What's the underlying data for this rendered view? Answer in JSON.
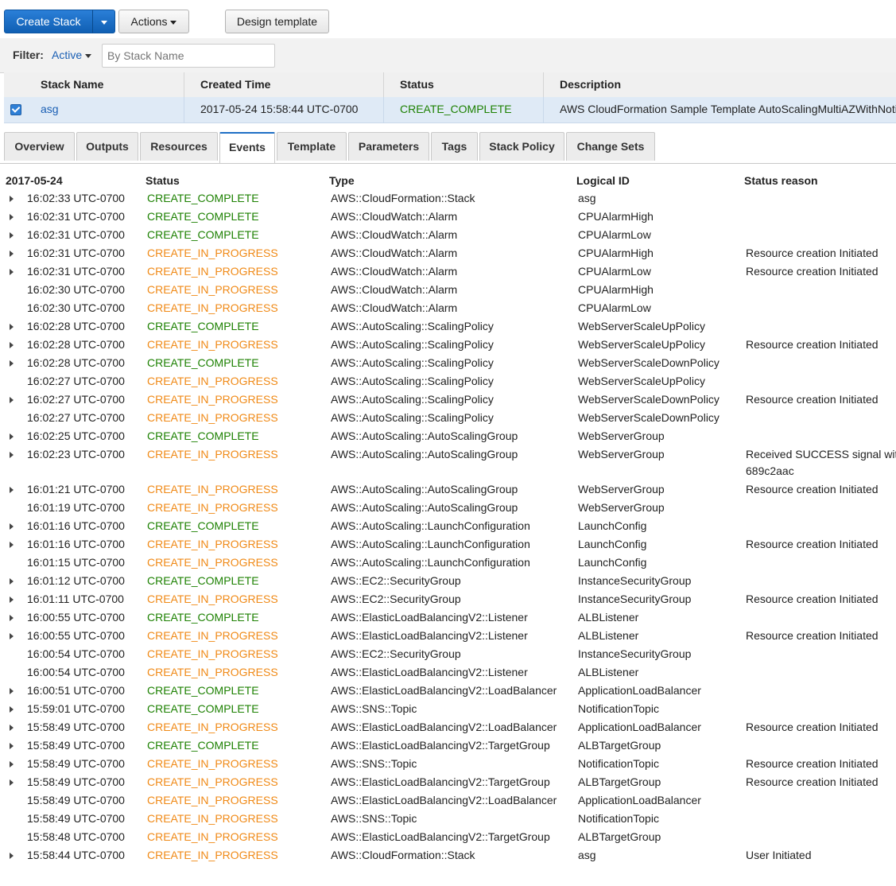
{
  "toolbar": {
    "create_stack": "Create Stack",
    "actions": "Actions",
    "design_template": "Design template"
  },
  "filter": {
    "label": "Filter:",
    "value": "Active",
    "search_placeholder": "By Stack Name"
  },
  "stack_table": {
    "headers": [
      "Stack Name",
      "Created Time",
      "Status",
      "Description"
    ],
    "row": {
      "name": "asg",
      "created": "2017-05-24 15:58:44 UTC-0700",
      "status": "CREATE_COMPLETE",
      "description": "AWS CloudFormation Sample Template AutoScalingMultiAZWithNotifications"
    }
  },
  "tabs": [
    "Overview",
    "Outputs",
    "Resources",
    "Events",
    "Template",
    "Parameters",
    "Tags",
    "Stack Policy",
    "Change Sets"
  ],
  "active_tab": "Events",
  "events": {
    "headers": {
      "date": "2017-05-24",
      "status": "Status",
      "type": "Type",
      "logical_id": "Logical ID",
      "reason": "Status reason"
    },
    "rows": [
      {
        "expandable": true,
        "time": "16:02:33 UTC-0700",
        "status": "CREATE_COMPLETE",
        "type": "AWS::CloudFormation::Stack",
        "logical_id": "asg",
        "reason": ""
      },
      {
        "expandable": true,
        "time": "16:02:31 UTC-0700",
        "status": "CREATE_COMPLETE",
        "type": "AWS::CloudWatch::Alarm",
        "logical_id": "CPUAlarmHigh",
        "reason": ""
      },
      {
        "expandable": true,
        "time": "16:02:31 UTC-0700",
        "status": "CREATE_COMPLETE",
        "type": "AWS::CloudWatch::Alarm",
        "logical_id": "CPUAlarmLow",
        "reason": ""
      },
      {
        "expandable": true,
        "time": "16:02:31 UTC-0700",
        "status": "CREATE_IN_PROGRESS",
        "type": "AWS::CloudWatch::Alarm",
        "logical_id": "CPUAlarmHigh",
        "reason": "Resource creation Initiated"
      },
      {
        "expandable": true,
        "time": "16:02:31 UTC-0700",
        "status": "CREATE_IN_PROGRESS",
        "type": "AWS::CloudWatch::Alarm",
        "logical_id": "CPUAlarmLow",
        "reason": "Resource creation Initiated"
      },
      {
        "expandable": false,
        "time": "16:02:30 UTC-0700",
        "status": "CREATE_IN_PROGRESS",
        "type": "AWS::CloudWatch::Alarm",
        "logical_id": "CPUAlarmHigh",
        "reason": ""
      },
      {
        "expandable": false,
        "time": "16:02:30 UTC-0700",
        "status": "CREATE_IN_PROGRESS",
        "type": "AWS::CloudWatch::Alarm",
        "logical_id": "CPUAlarmLow",
        "reason": ""
      },
      {
        "expandable": true,
        "time": "16:02:28 UTC-0700",
        "status": "CREATE_COMPLETE",
        "type": "AWS::AutoScaling::ScalingPolicy",
        "logical_id": "WebServerScaleUpPolicy",
        "reason": ""
      },
      {
        "expandable": true,
        "time": "16:02:28 UTC-0700",
        "status": "CREATE_IN_PROGRESS",
        "type": "AWS::AutoScaling::ScalingPolicy",
        "logical_id": "WebServerScaleUpPolicy",
        "reason": "Resource creation Initiated"
      },
      {
        "expandable": true,
        "time": "16:02:28 UTC-0700",
        "status": "CREATE_COMPLETE",
        "type": "AWS::AutoScaling::ScalingPolicy",
        "logical_id": "WebServerScaleDownPolicy",
        "reason": ""
      },
      {
        "expandable": false,
        "time": "16:02:27 UTC-0700",
        "status": "CREATE_IN_PROGRESS",
        "type": "AWS::AutoScaling::ScalingPolicy",
        "logical_id": "WebServerScaleUpPolicy",
        "reason": ""
      },
      {
        "expandable": true,
        "time": "16:02:27 UTC-0700",
        "status": "CREATE_IN_PROGRESS",
        "type": "AWS::AutoScaling::ScalingPolicy",
        "logical_id": "WebServerScaleDownPolicy",
        "reason": "Resource creation Initiated"
      },
      {
        "expandable": false,
        "time": "16:02:27 UTC-0700",
        "status": "CREATE_IN_PROGRESS",
        "type": "AWS::AutoScaling::ScalingPolicy",
        "logical_id": "WebServerScaleDownPolicy",
        "reason": ""
      },
      {
        "expandable": true,
        "time": "16:02:25 UTC-0700",
        "status": "CREATE_COMPLETE",
        "type": "AWS::AutoScaling::AutoScalingGroup",
        "logical_id": "WebServerGroup",
        "reason": ""
      },
      {
        "expandable": true,
        "time": "16:02:23 UTC-0700",
        "status": "CREATE_IN_PROGRESS",
        "type": "AWS::AutoScaling::AutoScalingGroup",
        "logical_id": "WebServerGroup",
        "reason": "Received SUCCESS signal wit",
        "reason2": "689c2aac"
      },
      {
        "expandable": true,
        "time": "16:01:21 UTC-0700",
        "status": "CREATE_IN_PROGRESS",
        "type": "AWS::AutoScaling::AutoScalingGroup",
        "logical_id": "WebServerGroup",
        "reason": "Resource creation Initiated"
      },
      {
        "expandable": false,
        "time": "16:01:19 UTC-0700",
        "status": "CREATE_IN_PROGRESS",
        "type": "AWS::AutoScaling::AutoScalingGroup",
        "logical_id": "WebServerGroup",
        "reason": ""
      },
      {
        "expandable": true,
        "time": "16:01:16 UTC-0700",
        "status": "CREATE_COMPLETE",
        "type": "AWS::AutoScaling::LaunchConfiguration",
        "logical_id": "LaunchConfig",
        "reason": ""
      },
      {
        "expandable": true,
        "time": "16:01:16 UTC-0700",
        "status": "CREATE_IN_PROGRESS",
        "type": "AWS::AutoScaling::LaunchConfiguration",
        "logical_id": "LaunchConfig",
        "reason": "Resource creation Initiated"
      },
      {
        "expandable": false,
        "time": "16:01:15 UTC-0700",
        "status": "CREATE_IN_PROGRESS",
        "type": "AWS::AutoScaling::LaunchConfiguration",
        "logical_id": "LaunchConfig",
        "reason": ""
      },
      {
        "expandable": true,
        "time": "16:01:12 UTC-0700",
        "status": "CREATE_COMPLETE",
        "type": "AWS::EC2::SecurityGroup",
        "logical_id": "InstanceSecurityGroup",
        "reason": ""
      },
      {
        "expandable": true,
        "time": "16:01:11 UTC-0700",
        "status": "CREATE_IN_PROGRESS",
        "type": "AWS::EC2::SecurityGroup",
        "logical_id": "InstanceSecurityGroup",
        "reason": "Resource creation Initiated"
      },
      {
        "expandable": true,
        "time": "16:00:55 UTC-0700",
        "status": "CREATE_COMPLETE",
        "type": "AWS::ElasticLoadBalancingV2::Listener",
        "logical_id": "ALBListener",
        "reason": ""
      },
      {
        "expandable": true,
        "time": "16:00:55 UTC-0700",
        "status": "CREATE_IN_PROGRESS",
        "type": "AWS::ElasticLoadBalancingV2::Listener",
        "logical_id": "ALBListener",
        "reason": "Resource creation Initiated"
      },
      {
        "expandable": false,
        "time": "16:00:54 UTC-0700",
        "status": "CREATE_IN_PROGRESS",
        "type": "AWS::EC2::SecurityGroup",
        "logical_id": "InstanceSecurityGroup",
        "reason": ""
      },
      {
        "expandable": false,
        "time": "16:00:54 UTC-0700",
        "status": "CREATE_IN_PROGRESS",
        "type": "AWS::ElasticLoadBalancingV2::Listener",
        "logical_id": "ALBListener",
        "reason": ""
      },
      {
        "expandable": true,
        "time": "16:00:51 UTC-0700",
        "status": "CREATE_COMPLETE",
        "type": "AWS::ElasticLoadBalancingV2::LoadBalancer",
        "logical_id": "ApplicationLoadBalancer",
        "reason": ""
      },
      {
        "expandable": true,
        "time": "15:59:01 UTC-0700",
        "status": "CREATE_COMPLETE",
        "type": "AWS::SNS::Topic",
        "logical_id": "NotificationTopic",
        "reason": ""
      },
      {
        "expandable": true,
        "time": "15:58:49 UTC-0700",
        "status": "CREATE_IN_PROGRESS",
        "type": "AWS::ElasticLoadBalancingV2::LoadBalancer",
        "logical_id": "ApplicationLoadBalancer",
        "reason": "Resource creation Initiated"
      },
      {
        "expandable": true,
        "time": "15:58:49 UTC-0700",
        "status": "CREATE_COMPLETE",
        "type": "AWS::ElasticLoadBalancingV2::TargetGroup",
        "logical_id": "ALBTargetGroup",
        "reason": ""
      },
      {
        "expandable": true,
        "time": "15:58:49 UTC-0700",
        "status": "CREATE_IN_PROGRESS",
        "type": "AWS::SNS::Topic",
        "logical_id": "NotificationTopic",
        "reason": "Resource creation Initiated"
      },
      {
        "expandable": true,
        "time": "15:58:49 UTC-0700",
        "status": "CREATE_IN_PROGRESS",
        "type": "AWS::ElasticLoadBalancingV2::TargetGroup",
        "logical_id": "ALBTargetGroup",
        "reason": "Resource creation Initiated"
      },
      {
        "expandable": false,
        "time": "15:58:49 UTC-0700",
        "status": "CREATE_IN_PROGRESS",
        "type": "AWS::ElasticLoadBalancingV2::LoadBalancer",
        "logical_id": "ApplicationLoadBalancer",
        "reason": ""
      },
      {
        "expandable": false,
        "time": "15:58:49 UTC-0700",
        "status": "CREATE_IN_PROGRESS",
        "type": "AWS::SNS::Topic",
        "logical_id": "NotificationTopic",
        "reason": ""
      },
      {
        "expandable": false,
        "time": "15:58:48 UTC-0700",
        "status": "CREATE_IN_PROGRESS",
        "type": "AWS::ElasticLoadBalancingV2::TargetGroup",
        "logical_id": "ALBTargetGroup",
        "reason": ""
      },
      {
        "expandable": true,
        "time": "15:58:44 UTC-0700",
        "status": "CREATE_IN_PROGRESS",
        "type": "AWS::CloudFormation::Stack",
        "logical_id": "asg",
        "reason": "User Initiated"
      }
    ]
  },
  "colors": {
    "complete": "#1d8102",
    "in_progress": "#f08a17",
    "primary_button": "#1565c0",
    "selected_row": "#dfeaf6"
  }
}
